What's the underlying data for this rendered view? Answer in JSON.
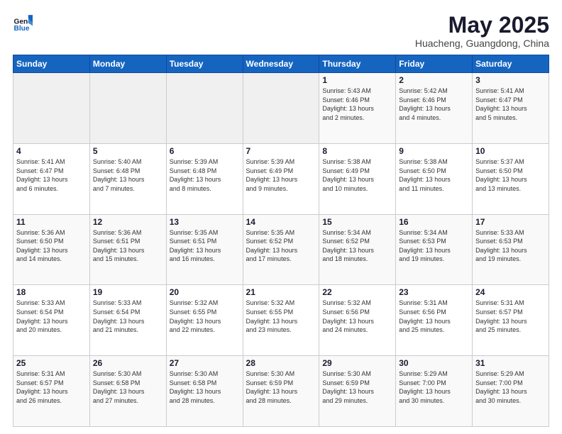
{
  "logo": {
    "general": "General",
    "blue": "Blue"
  },
  "header": {
    "title": "May 2025",
    "subtitle": "Huacheng, Guangdong, China"
  },
  "weekdays": [
    "Sunday",
    "Monday",
    "Tuesday",
    "Wednesday",
    "Thursday",
    "Friday",
    "Saturday"
  ],
  "weeks": [
    [
      {
        "day": "",
        "content": ""
      },
      {
        "day": "",
        "content": ""
      },
      {
        "day": "",
        "content": ""
      },
      {
        "day": "",
        "content": ""
      },
      {
        "day": "1",
        "content": "Sunrise: 5:43 AM\nSunset: 6:46 PM\nDaylight: 13 hours\nand 2 minutes."
      },
      {
        "day": "2",
        "content": "Sunrise: 5:42 AM\nSunset: 6:46 PM\nDaylight: 13 hours\nand 4 minutes."
      },
      {
        "day": "3",
        "content": "Sunrise: 5:41 AM\nSunset: 6:47 PM\nDaylight: 13 hours\nand 5 minutes."
      }
    ],
    [
      {
        "day": "4",
        "content": "Sunrise: 5:41 AM\nSunset: 6:47 PM\nDaylight: 13 hours\nand 6 minutes."
      },
      {
        "day": "5",
        "content": "Sunrise: 5:40 AM\nSunset: 6:48 PM\nDaylight: 13 hours\nand 7 minutes."
      },
      {
        "day": "6",
        "content": "Sunrise: 5:39 AM\nSunset: 6:48 PM\nDaylight: 13 hours\nand 8 minutes."
      },
      {
        "day": "7",
        "content": "Sunrise: 5:39 AM\nSunset: 6:49 PM\nDaylight: 13 hours\nand 9 minutes."
      },
      {
        "day": "8",
        "content": "Sunrise: 5:38 AM\nSunset: 6:49 PM\nDaylight: 13 hours\nand 10 minutes."
      },
      {
        "day": "9",
        "content": "Sunrise: 5:38 AM\nSunset: 6:50 PM\nDaylight: 13 hours\nand 11 minutes."
      },
      {
        "day": "10",
        "content": "Sunrise: 5:37 AM\nSunset: 6:50 PM\nDaylight: 13 hours\nand 13 minutes."
      }
    ],
    [
      {
        "day": "11",
        "content": "Sunrise: 5:36 AM\nSunset: 6:50 PM\nDaylight: 13 hours\nand 14 minutes."
      },
      {
        "day": "12",
        "content": "Sunrise: 5:36 AM\nSunset: 6:51 PM\nDaylight: 13 hours\nand 15 minutes."
      },
      {
        "day": "13",
        "content": "Sunrise: 5:35 AM\nSunset: 6:51 PM\nDaylight: 13 hours\nand 16 minutes."
      },
      {
        "day": "14",
        "content": "Sunrise: 5:35 AM\nSunset: 6:52 PM\nDaylight: 13 hours\nand 17 minutes."
      },
      {
        "day": "15",
        "content": "Sunrise: 5:34 AM\nSunset: 6:52 PM\nDaylight: 13 hours\nand 18 minutes."
      },
      {
        "day": "16",
        "content": "Sunrise: 5:34 AM\nSunset: 6:53 PM\nDaylight: 13 hours\nand 19 minutes."
      },
      {
        "day": "17",
        "content": "Sunrise: 5:33 AM\nSunset: 6:53 PM\nDaylight: 13 hours\nand 19 minutes."
      }
    ],
    [
      {
        "day": "18",
        "content": "Sunrise: 5:33 AM\nSunset: 6:54 PM\nDaylight: 13 hours\nand 20 minutes."
      },
      {
        "day": "19",
        "content": "Sunrise: 5:33 AM\nSunset: 6:54 PM\nDaylight: 13 hours\nand 21 minutes."
      },
      {
        "day": "20",
        "content": "Sunrise: 5:32 AM\nSunset: 6:55 PM\nDaylight: 13 hours\nand 22 minutes."
      },
      {
        "day": "21",
        "content": "Sunrise: 5:32 AM\nSunset: 6:55 PM\nDaylight: 13 hours\nand 23 minutes."
      },
      {
        "day": "22",
        "content": "Sunrise: 5:32 AM\nSunset: 6:56 PM\nDaylight: 13 hours\nand 24 minutes."
      },
      {
        "day": "23",
        "content": "Sunrise: 5:31 AM\nSunset: 6:56 PM\nDaylight: 13 hours\nand 25 minutes."
      },
      {
        "day": "24",
        "content": "Sunrise: 5:31 AM\nSunset: 6:57 PM\nDaylight: 13 hours\nand 25 minutes."
      }
    ],
    [
      {
        "day": "25",
        "content": "Sunrise: 5:31 AM\nSunset: 6:57 PM\nDaylight: 13 hours\nand 26 minutes."
      },
      {
        "day": "26",
        "content": "Sunrise: 5:30 AM\nSunset: 6:58 PM\nDaylight: 13 hours\nand 27 minutes."
      },
      {
        "day": "27",
        "content": "Sunrise: 5:30 AM\nSunset: 6:58 PM\nDaylight: 13 hours\nand 28 minutes."
      },
      {
        "day": "28",
        "content": "Sunrise: 5:30 AM\nSunset: 6:59 PM\nDaylight: 13 hours\nand 28 minutes."
      },
      {
        "day": "29",
        "content": "Sunrise: 5:30 AM\nSunset: 6:59 PM\nDaylight: 13 hours\nand 29 minutes."
      },
      {
        "day": "30",
        "content": "Sunrise: 5:29 AM\nSunset: 7:00 PM\nDaylight: 13 hours\nand 30 minutes."
      },
      {
        "day": "31",
        "content": "Sunrise: 5:29 AM\nSunset: 7:00 PM\nDaylight: 13 hours\nand 30 minutes."
      }
    ]
  ]
}
